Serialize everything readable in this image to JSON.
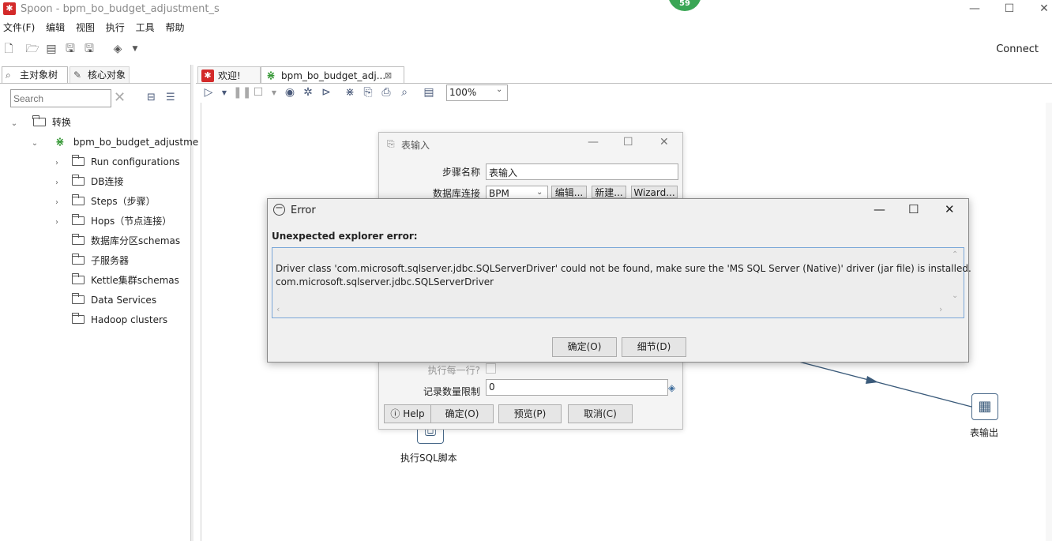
{
  "window": {
    "title": "Spoon - bpm_bo_budget_adjustment_s",
    "badge": "59",
    "controls": {
      "minimize": "—",
      "maximize": "☐",
      "close": "✕"
    }
  },
  "menubar": {
    "items": [
      "文件(F)",
      "编辑",
      "视图",
      "执行",
      "工具",
      "帮助"
    ]
  },
  "toolbar": {
    "connect_label": "Connect"
  },
  "left_panel": {
    "tabs": [
      {
        "label": "主对象树"
      },
      {
        "label": "核心对象"
      }
    ],
    "search_placeholder": "Search",
    "tree": {
      "root": "转换",
      "transformation": "bpm_bo_budget_adjustme",
      "children": [
        {
          "label": "Run configurations",
          "expandable": true
        },
        {
          "label": "DB连接",
          "expandable": true
        },
        {
          "label": "Steps（步骤）",
          "expandable": true
        },
        {
          "label": "Hops（节点连接）",
          "expandable": true
        },
        {
          "label": "数据库分区schemas",
          "expandable": false
        },
        {
          "label": "子服务器",
          "expandable": false
        },
        {
          "label": "Kettle集群schemas",
          "expandable": false
        },
        {
          "label": "Data Services",
          "expandable": false
        },
        {
          "label": "Hadoop clusters",
          "expandable": false
        }
      ]
    }
  },
  "editor": {
    "tabs": [
      {
        "label": "欢迎!"
      },
      {
        "label": "bpm_bo_budget_adj..."
      }
    ],
    "zoom": "100%"
  },
  "canvas": {
    "steps": [
      {
        "label": "执行SQL脚本"
      },
      {
        "label": "表输出"
      }
    ]
  },
  "table_input_dialog": {
    "title": "表输入",
    "step_name_label": "步骤名称",
    "step_name_value": "表输入",
    "db_connection_label": "数据库连接",
    "db_connection_value": "BPM",
    "edit_button": "编辑...",
    "new_button": "新建...",
    "wizard_button": "Wizard...",
    "execute_each_row_label": "执行每一行?",
    "limit_label": "记录数量限制",
    "limit_value": "0",
    "help_button": "Help",
    "ok_button": "确定(O)",
    "preview_button": "预览(P)",
    "cancel_button": "取消(C)"
  },
  "error_dialog": {
    "title": "Error",
    "heading": "Unexpected explorer error:",
    "message_line1": "Driver class 'com.microsoft.sqlserver.jdbc.SQLServerDriver' could not be found, make sure the 'MS SQL Server (Native)' driver (jar file) is installed.",
    "message_line2": "com.microsoft.sqlserver.jdbc.SQLServerDriver",
    "ok_button": "确定(O)",
    "details_button": "细节(D)"
  }
}
